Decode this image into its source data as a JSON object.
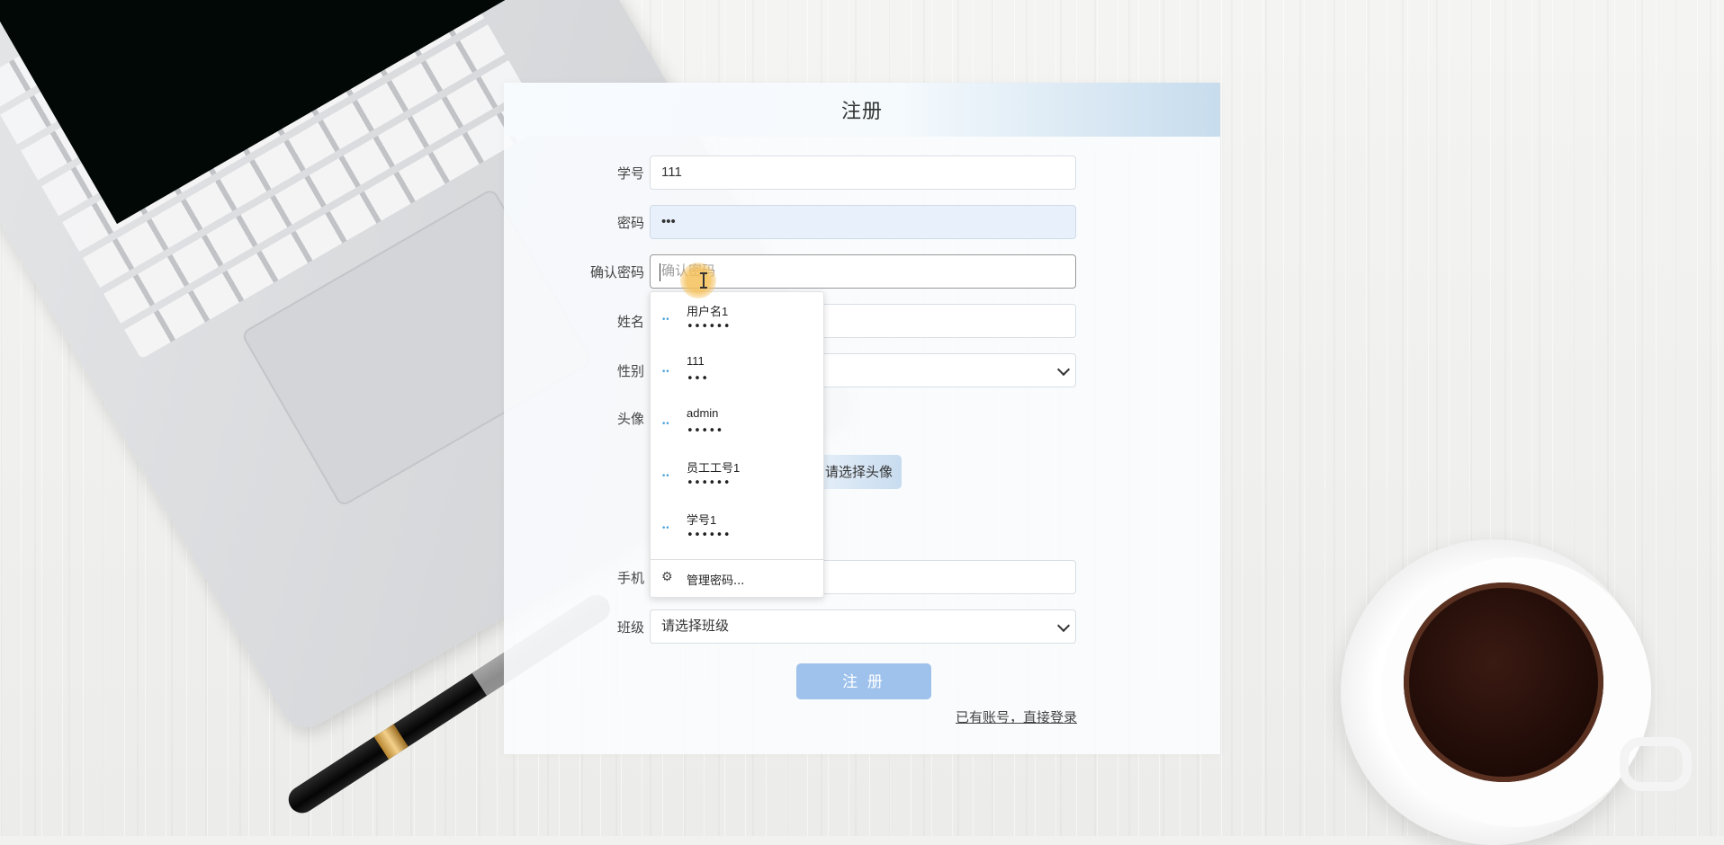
{
  "panel": {
    "title": "注册"
  },
  "form": {
    "student_id": {
      "label": "学号",
      "value": "111"
    },
    "password": {
      "label": "密码",
      "value": "•••"
    },
    "confirm_password": {
      "label": "确认密码",
      "placeholder": "确认密码",
      "value": ""
    },
    "name": {
      "label": "姓名",
      "value": ""
    },
    "gender": {
      "label": "性别",
      "value": ""
    },
    "avatar": {
      "label": "头像",
      "button_label": "请选择头像"
    },
    "phone": {
      "label": "手机",
      "value": ""
    },
    "class": {
      "label": "班级",
      "value": "请选择班级"
    },
    "submit_label": "注 册",
    "login_link": "已有账号，直接登录"
  },
  "autocomplete": {
    "items": [
      {
        "username": "用户名1",
        "password": "••••••"
      },
      {
        "username": "111",
        "password": "•••"
      },
      {
        "username": "admin",
        "password": "•••••"
      },
      {
        "username": "员工工号1",
        "password": "••••••"
      },
      {
        "username": "学号1",
        "password": "••••••"
      }
    ],
    "key_icon": "••",
    "manage_label": "管理密码..."
  },
  "colors": {
    "accent": "#9ec2ec",
    "header_gradient_end": "#c7dced",
    "autofill_bg": "#e8f0fb"
  }
}
